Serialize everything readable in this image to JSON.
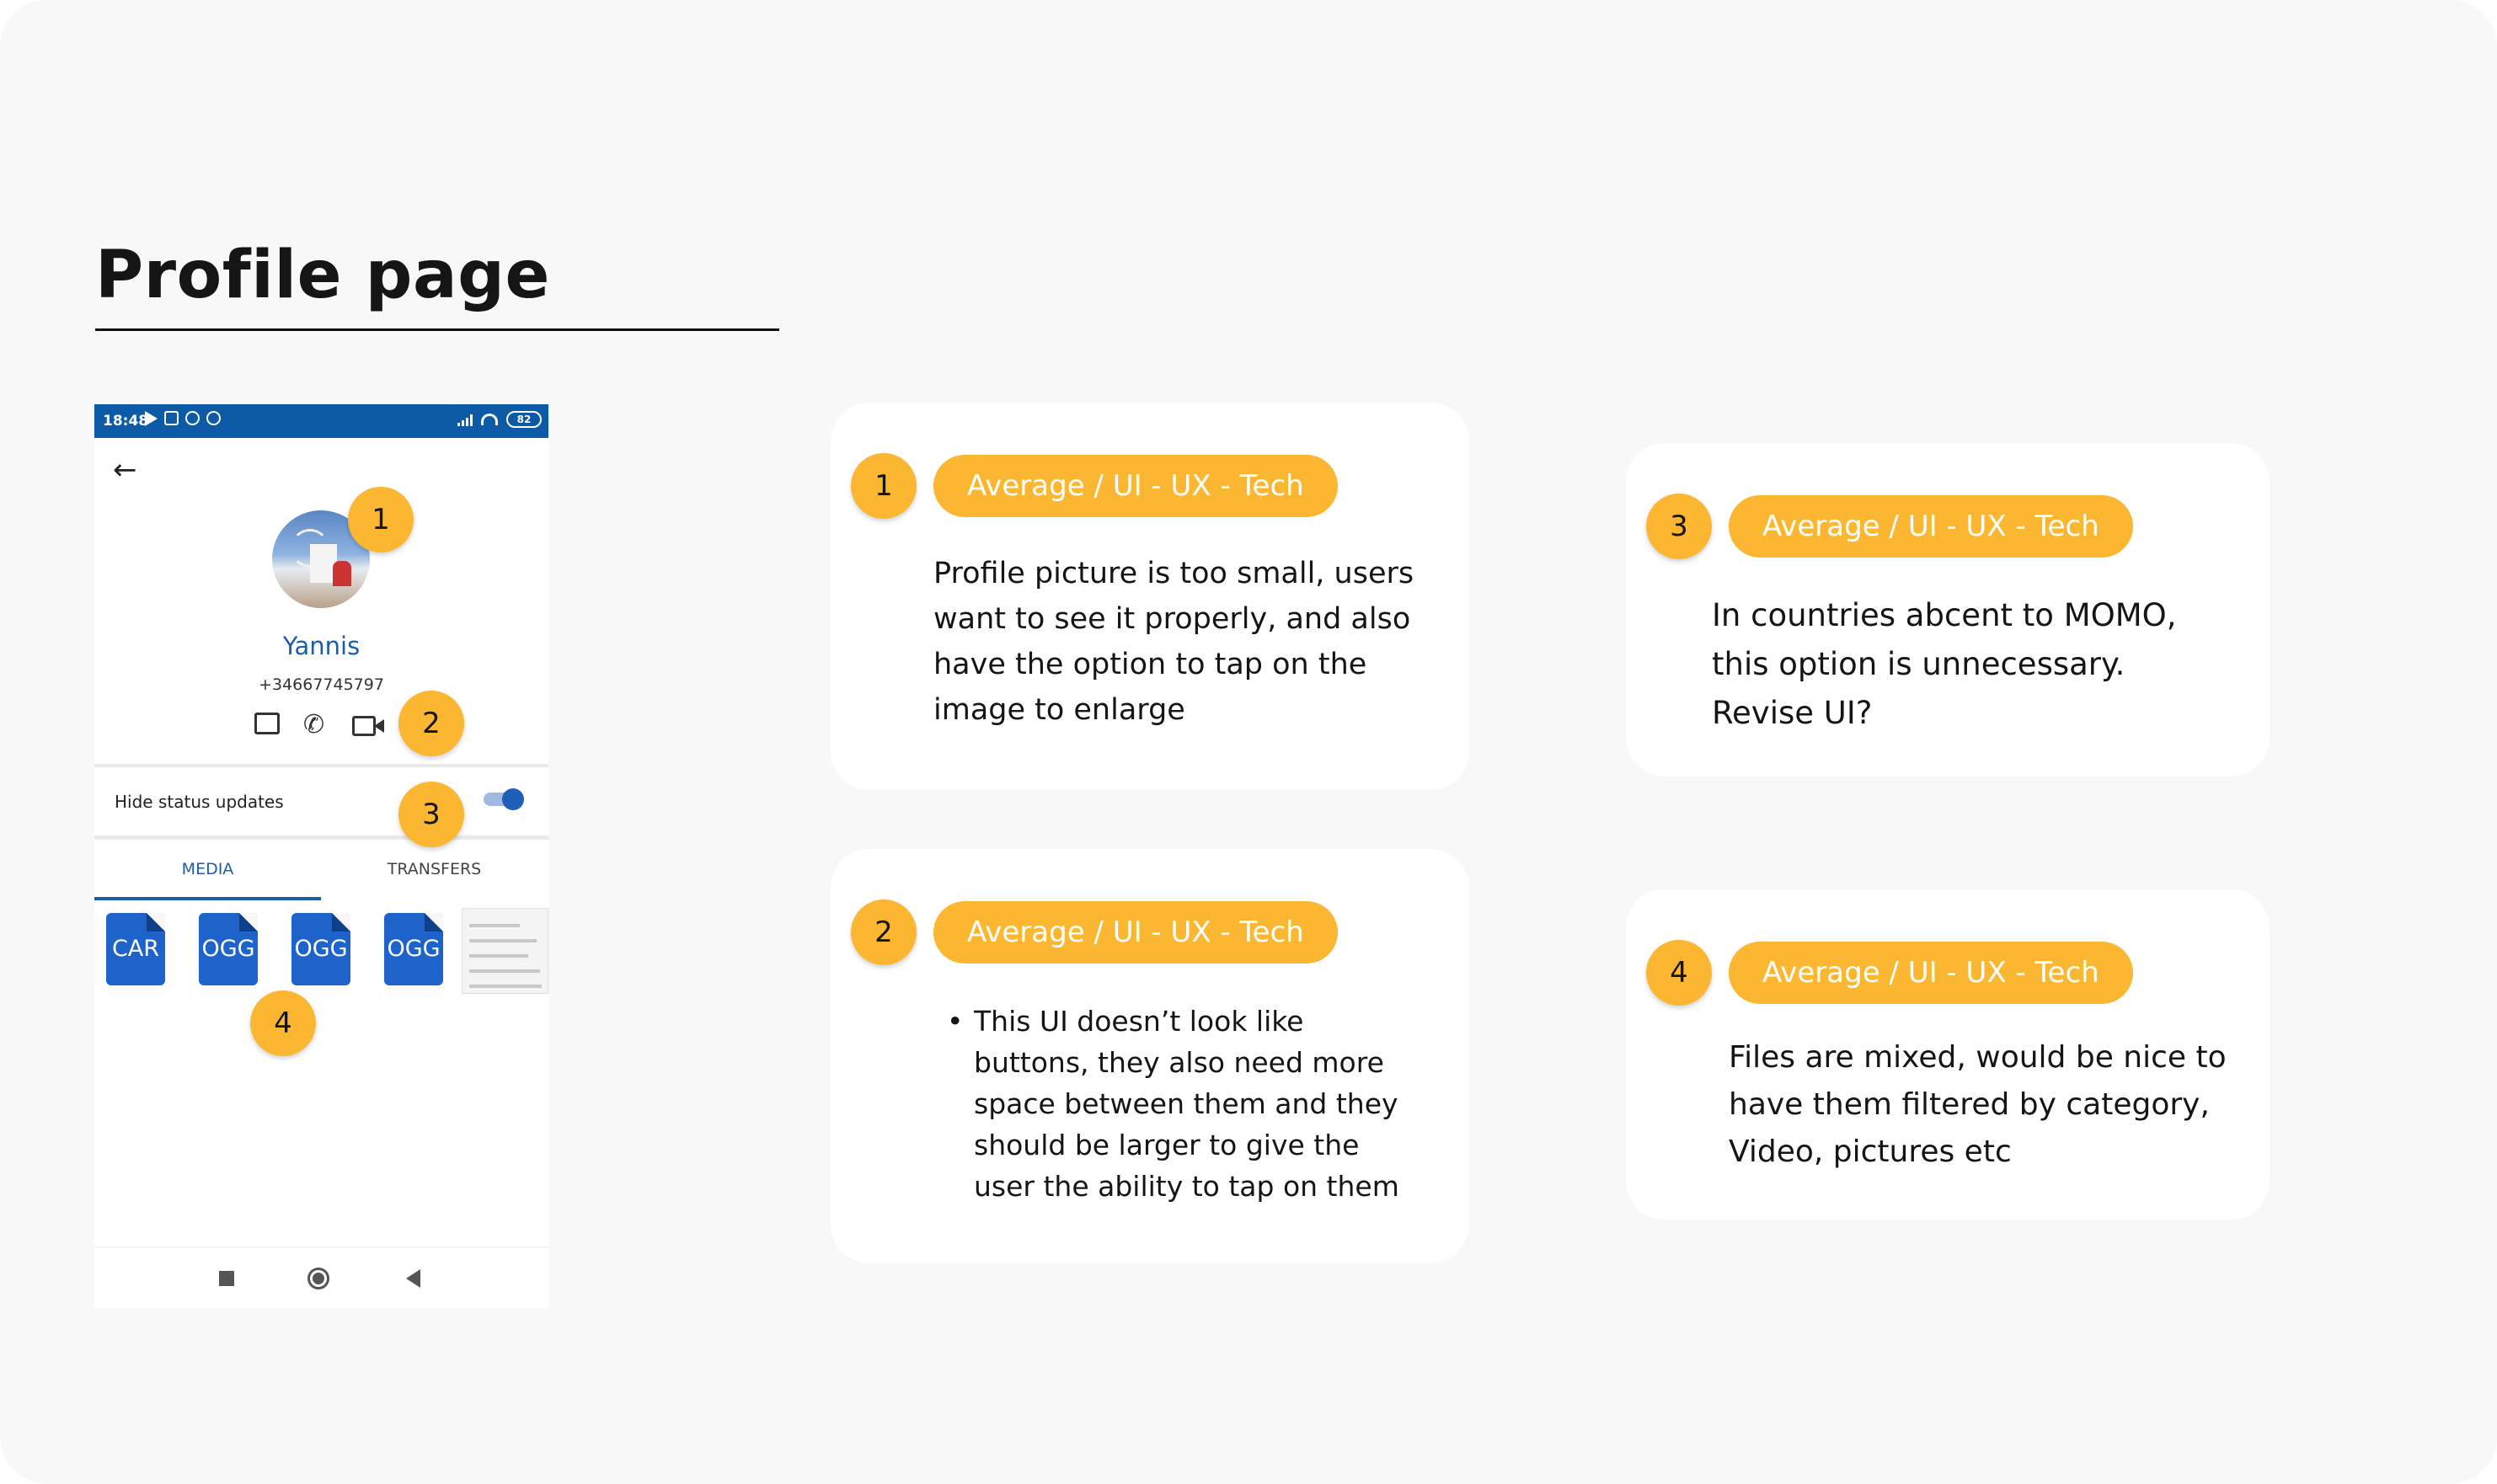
{
  "page_title": "Profile page",
  "phone": {
    "status_time": "18:48",
    "battery": "82",
    "profile_name": "Yannis",
    "profile_phone": "+34667745797",
    "hide_status_label": "Hide status updates",
    "hide_status_enabled": true,
    "tabs": [
      "MEDIA",
      "TRANSFERS"
    ],
    "files": [
      "CAR",
      "OGG",
      "OGG",
      "OGG"
    ]
  },
  "markers": [
    "1",
    "2",
    "3",
    "4"
  ],
  "cards": [
    {
      "number": "1",
      "tag": "Average / UI - UX - Tech",
      "text": "Profile picture is too small, users want to see it properly, and also have the option to tap on the image to enlarge"
    },
    {
      "number": "2",
      "tag": "Average / UI - UX - Tech",
      "text": "This UI doesn’t look like buttons, they also need more space between them and they should be larger to give the user the ability to tap on them"
    },
    {
      "number": "3",
      "tag": "Average / UI - UX - Tech",
      "text": "In countries abcent to MOMO, this option is unnecessary. Revise UI?"
    },
    {
      "number": "4",
      "tag": "Average / UI - UX - Tech",
      "text": "Files are mixed, would be nice to have them filtered  by category, Video, pictures etc"
    }
  ],
  "colors": {
    "accent": "#fbb731",
    "brand_blue": "#0d5aa7",
    "card_bg": "#ffffff",
    "board_bg": "#f8f8f8"
  },
  "icons": [
    "back-arrow-icon",
    "chat-icon",
    "phone-icon",
    "video-icon",
    "square-nav-icon",
    "home-nav-icon",
    "back-nav-icon"
  ]
}
